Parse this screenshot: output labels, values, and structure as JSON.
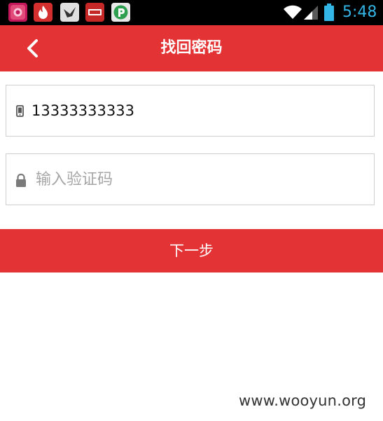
{
  "status_bar": {
    "time": "5:48",
    "time_color": "#33b5e5",
    "notification_icons": [
      "app-icon-pink",
      "app-icon-flame",
      "app-icon-bird",
      "app-icon-red-badge",
      "app-icon-green-p"
    ],
    "status_icons": [
      "wifi-icon",
      "cell-signal-icon",
      "battery-icon"
    ]
  },
  "header": {
    "back_icon": "chevron-left-icon",
    "title": "找回密码",
    "background_color": "#e33335"
  },
  "form": {
    "phone": {
      "icon": "phone-icon",
      "value": "13333333333",
      "placeholder": ""
    },
    "code": {
      "icon": "lock-icon",
      "value": "",
      "placeholder": "输入验证码"
    },
    "next_label": "下一步"
  },
  "watermark": "www.wooyun.org"
}
